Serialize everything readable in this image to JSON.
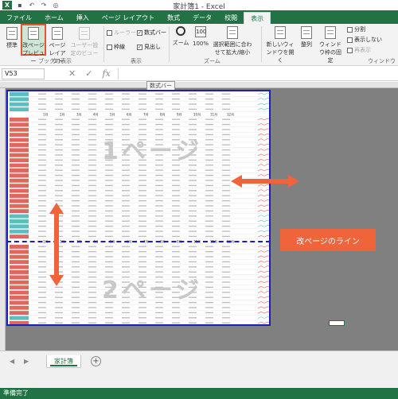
{
  "window": {
    "title": "家計簿1 - Excel",
    "app_icon": "X"
  },
  "quick_access": [
    {
      "name": "save-icon",
      "glyph": "💾"
    },
    {
      "name": "undo-icon",
      "glyph": "↶"
    },
    {
      "name": "redo-icon",
      "glyph": "↷"
    },
    {
      "name": "preview-icon",
      "glyph": "🔍"
    }
  ],
  "tabs": {
    "file": "ファイル",
    "items": [
      "ホーム",
      "挿入",
      "ページ レイアウト",
      "数式",
      "データ",
      "校閲"
    ],
    "active": "表示"
  },
  "ribbon": {
    "normal": "標準",
    "page_break_preview": "改ページプレビュー",
    "page_layout": "ページレイアウト",
    "custom_views": "ユーザー設定のビュー",
    "group_views": "ブックの表示",
    "ruler": "ルーラー",
    "formula_bar": "数式バー",
    "gridlines": "枠線",
    "headings": "見出し",
    "group_show": "表示",
    "zoom": "ズーム",
    "zoom_100": "100%",
    "zoom_selection": "選択範囲に合わせて拡大/縮小",
    "group_zoom": "ズーム",
    "new_window": "新しいウィンドウを開く",
    "arrange": "整列",
    "freeze": "ウィンドウ枠の固定",
    "split": "分割",
    "hide": "表示しない",
    "unhide": "再表示",
    "group_window": "ウィンドウ"
  },
  "formula_bar": {
    "name_box": "V53",
    "tooltip": "数式バー"
  },
  "annotations": {
    "page_break_line": "改ページのライン"
  },
  "watermarks": {
    "page1": "1ページ",
    "page2": "2ページ"
  },
  "sheet": {
    "tab": "家計簿",
    "status": "準備完了",
    "month_headers": [
      "1月",
      "2月",
      "3月",
      "4月",
      "5月",
      "6月",
      "7月",
      "8月",
      "9月",
      "10月",
      "11月",
      "12月"
    ]
  },
  "colors": {
    "excel_green": "#217346",
    "page_border": "#1c1cc4",
    "highlight": "#e2572f",
    "callout": "#f0643c",
    "row_red": "#e0665e",
    "row_teal": "#5bbfc0"
  }
}
